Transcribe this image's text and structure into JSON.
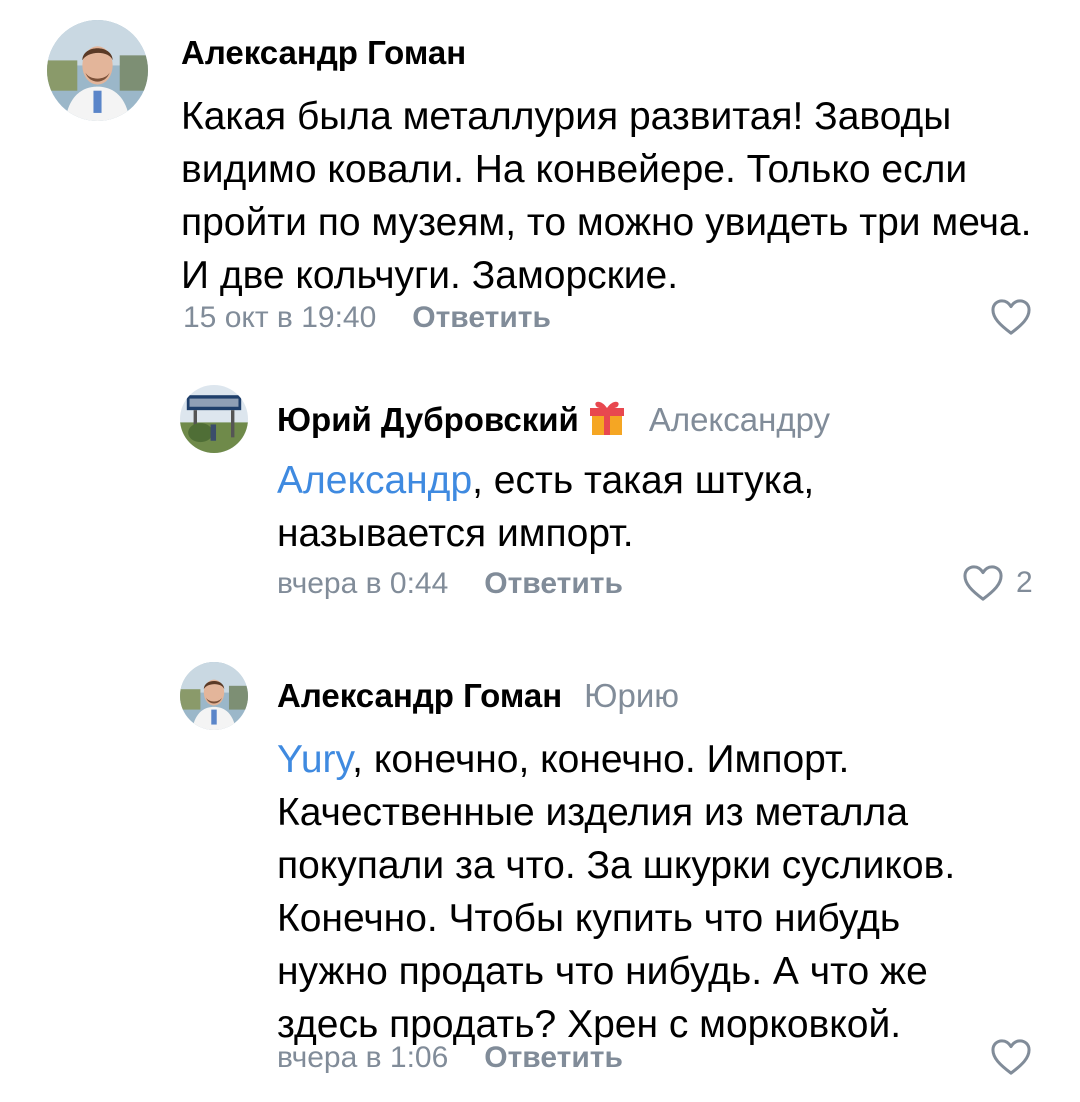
{
  "comments": [
    {
      "author": "Александр Гоман",
      "reply_to": "",
      "mention": "",
      "text": "Какая была металлурия развитая! Заводы видимо ковали. На конвейере. Только если пройти по музеям, то можно увидеть три меча. И две кольчуги. Заморские.",
      "timestamp": "15 окт в 19:40",
      "reply_label": "Ответить",
      "likes": "",
      "avatar": "avatar-photo-man"
    },
    {
      "author": "Юрий Дубровский",
      "reply_to": "Александру",
      "mention": "Александр",
      "text": ", есть такая штука, называется импорт.",
      "timestamp": "вчера в 0:44",
      "reply_label": "Ответить",
      "likes": "2",
      "avatar": "avatar-photo-sign",
      "badge_icon": "gift-icon"
    },
    {
      "author": "Александр Гоман",
      "reply_to": "Юрию",
      "mention": "Yury",
      "text": ", конечно, конечно. Импорт. Качественные изделия из металла покупали за что. За шкурки сусликов. Конечно. Чтобы купить что нибудь нужно продать что нибудь. А что же здесь продать? Хрен с морковкой.",
      "timestamp": "вчера в 1:06",
      "reply_label": "Ответить",
      "likes": "",
      "avatar": "avatar-photo-man"
    }
  ],
  "colors": {
    "secondary_text": "#818c99",
    "mention": "#3f8ae0",
    "primary_text": "#000000"
  }
}
